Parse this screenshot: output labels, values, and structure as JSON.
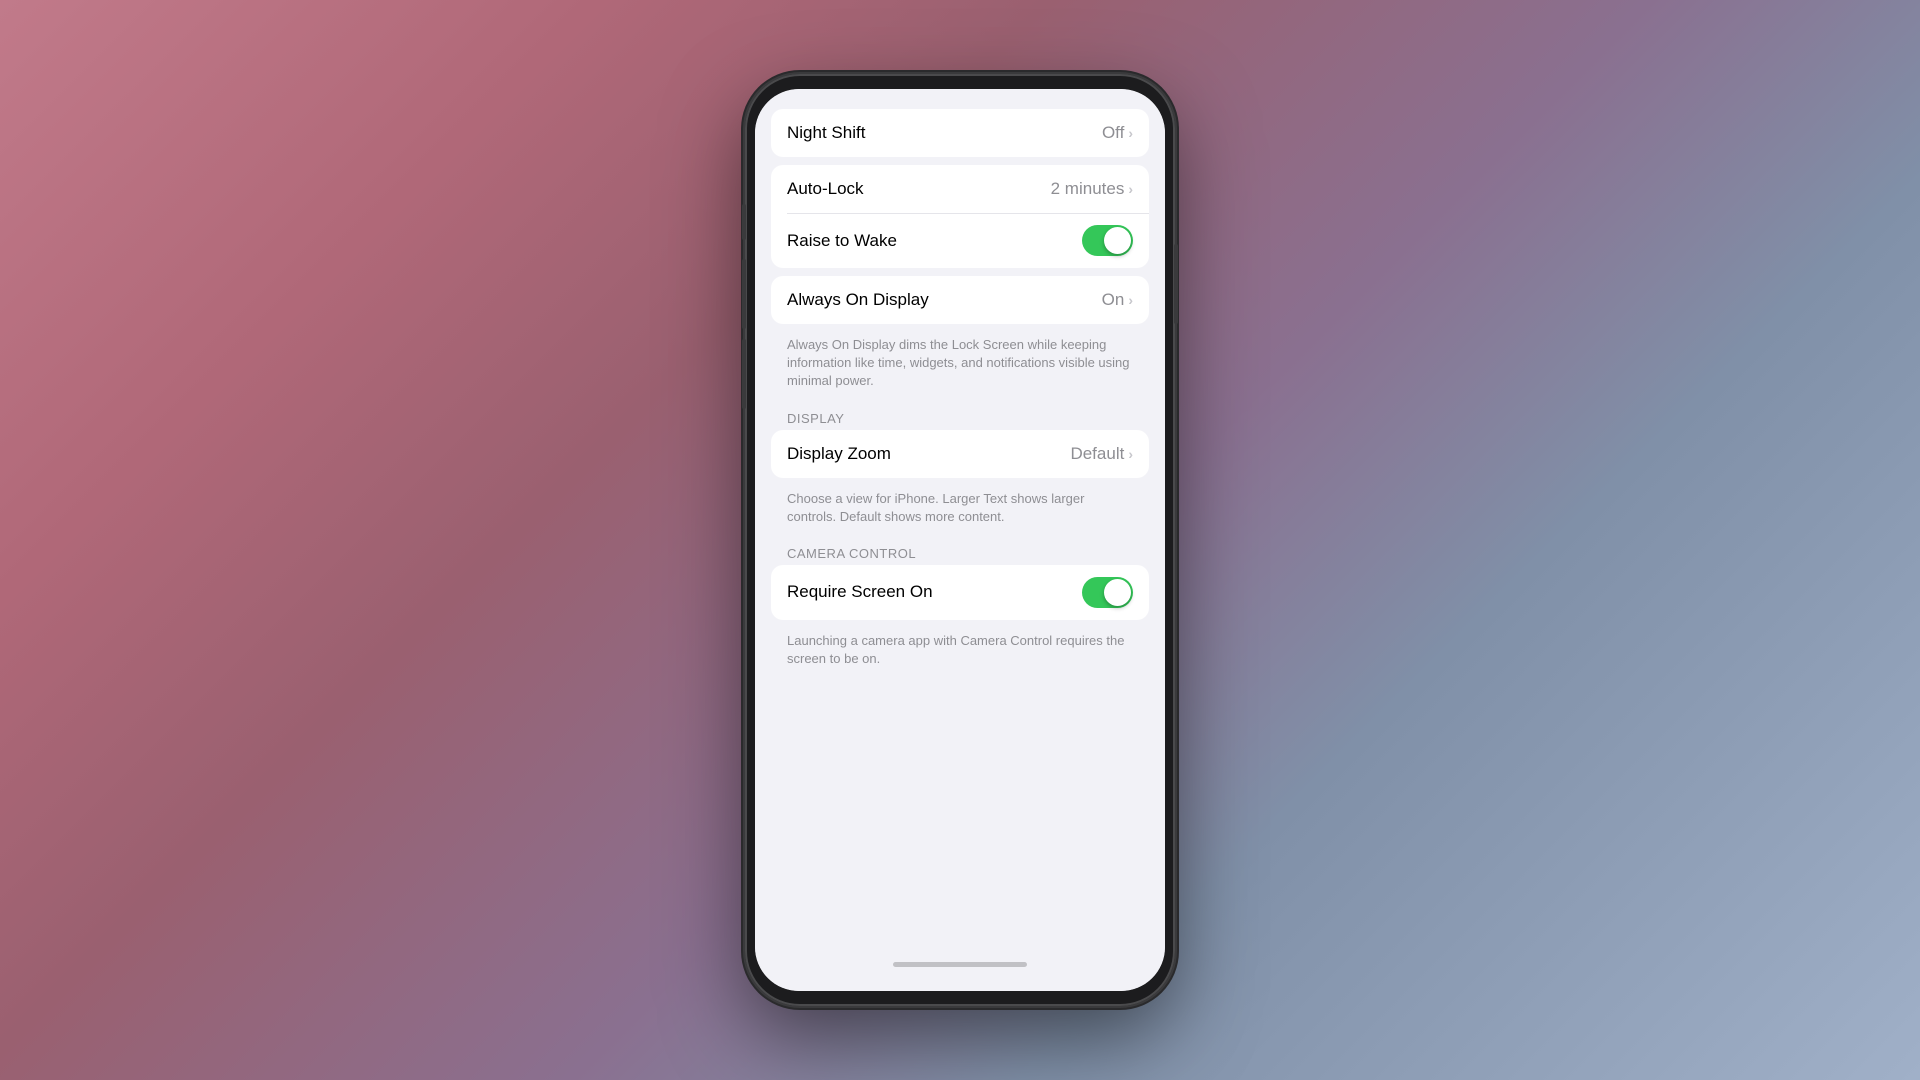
{
  "settings": {
    "groups": [
      {
        "id": "night-shift-group",
        "rows": [
          {
            "id": "night-shift",
            "label": "Night Shift",
            "value": "Off",
            "type": "navigation"
          }
        ]
      },
      {
        "id": "autolock-group",
        "rows": [
          {
            "id": "auto-lock",
            "label": "Auto-Lock",
            "value": "2 minutes",
            "type": "navigation"
          },
          {
            "id": "raise-to-wake",
            "label": "Raise to Wake",
            "value": null,
            "type": "toggle",
            "toggleOn": true
          }
        ]
      },
      {
        "id": "always-on-group",
        "rows": [
          {
            "id": "always-on-display",
            "label": "Always On Display",
            "value": "On",
            "type": "navigation"
          }
        ],
        "description": "Always On Display dims the Lock Screen while keeping information like time, widgets, and notifications visible using minimal power."
      },
      {
        "id": "display-zoom-group",
        "sectionLabel": "DISPLAY",
        "rows": [
          {
            "id": "display-zoom",
            "label": "Display Zoom",
            "value": "Default",
            "type": "navigation"
          }
        ],
        "description": "Choose a view for iPhone. Larger Text shows larger controls. Default shows more content."
      },
      {
        "id": "camera-control-group",
        "sectionLabel": "CAMERA CONTROL",
        "rows": [
          {
            "id": "require-screen-on",
            "label": "Require Screen On",
            "value": null,
            "type": "toggle",
            "toggleOn": true
          }
        ],
        "description": "Launching a camera app with Camera Control requires the screen to be on."
      }
    ]
  }
}
